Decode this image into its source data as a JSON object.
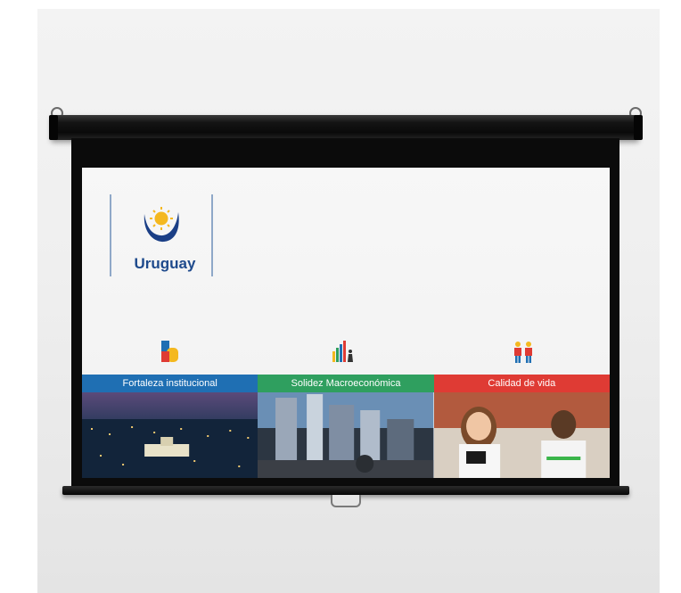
{
  "logo": {
    "text": "Uruguay",
    "emblem": "uruguay-sun-emblem"
  },
  "pillars": [
    {
      "label": "Fortaleza institucional",
      "icon": "institution-icon",
      "color": "#1f6fb3",
      "photo": "night-city-photo"
    },
    {
      "label": "Solidez Macroeconómica",
      "icon": "bar-chart-icon",
      "color": "#2f9f5f",
      "photo": "skyline-photo"
    },
    {
      "label": "Calidad de vida",
      "icon": "people-icon",
      "color": "#df3b34",
      "photo": "children-photo"
    }
  ]
}
